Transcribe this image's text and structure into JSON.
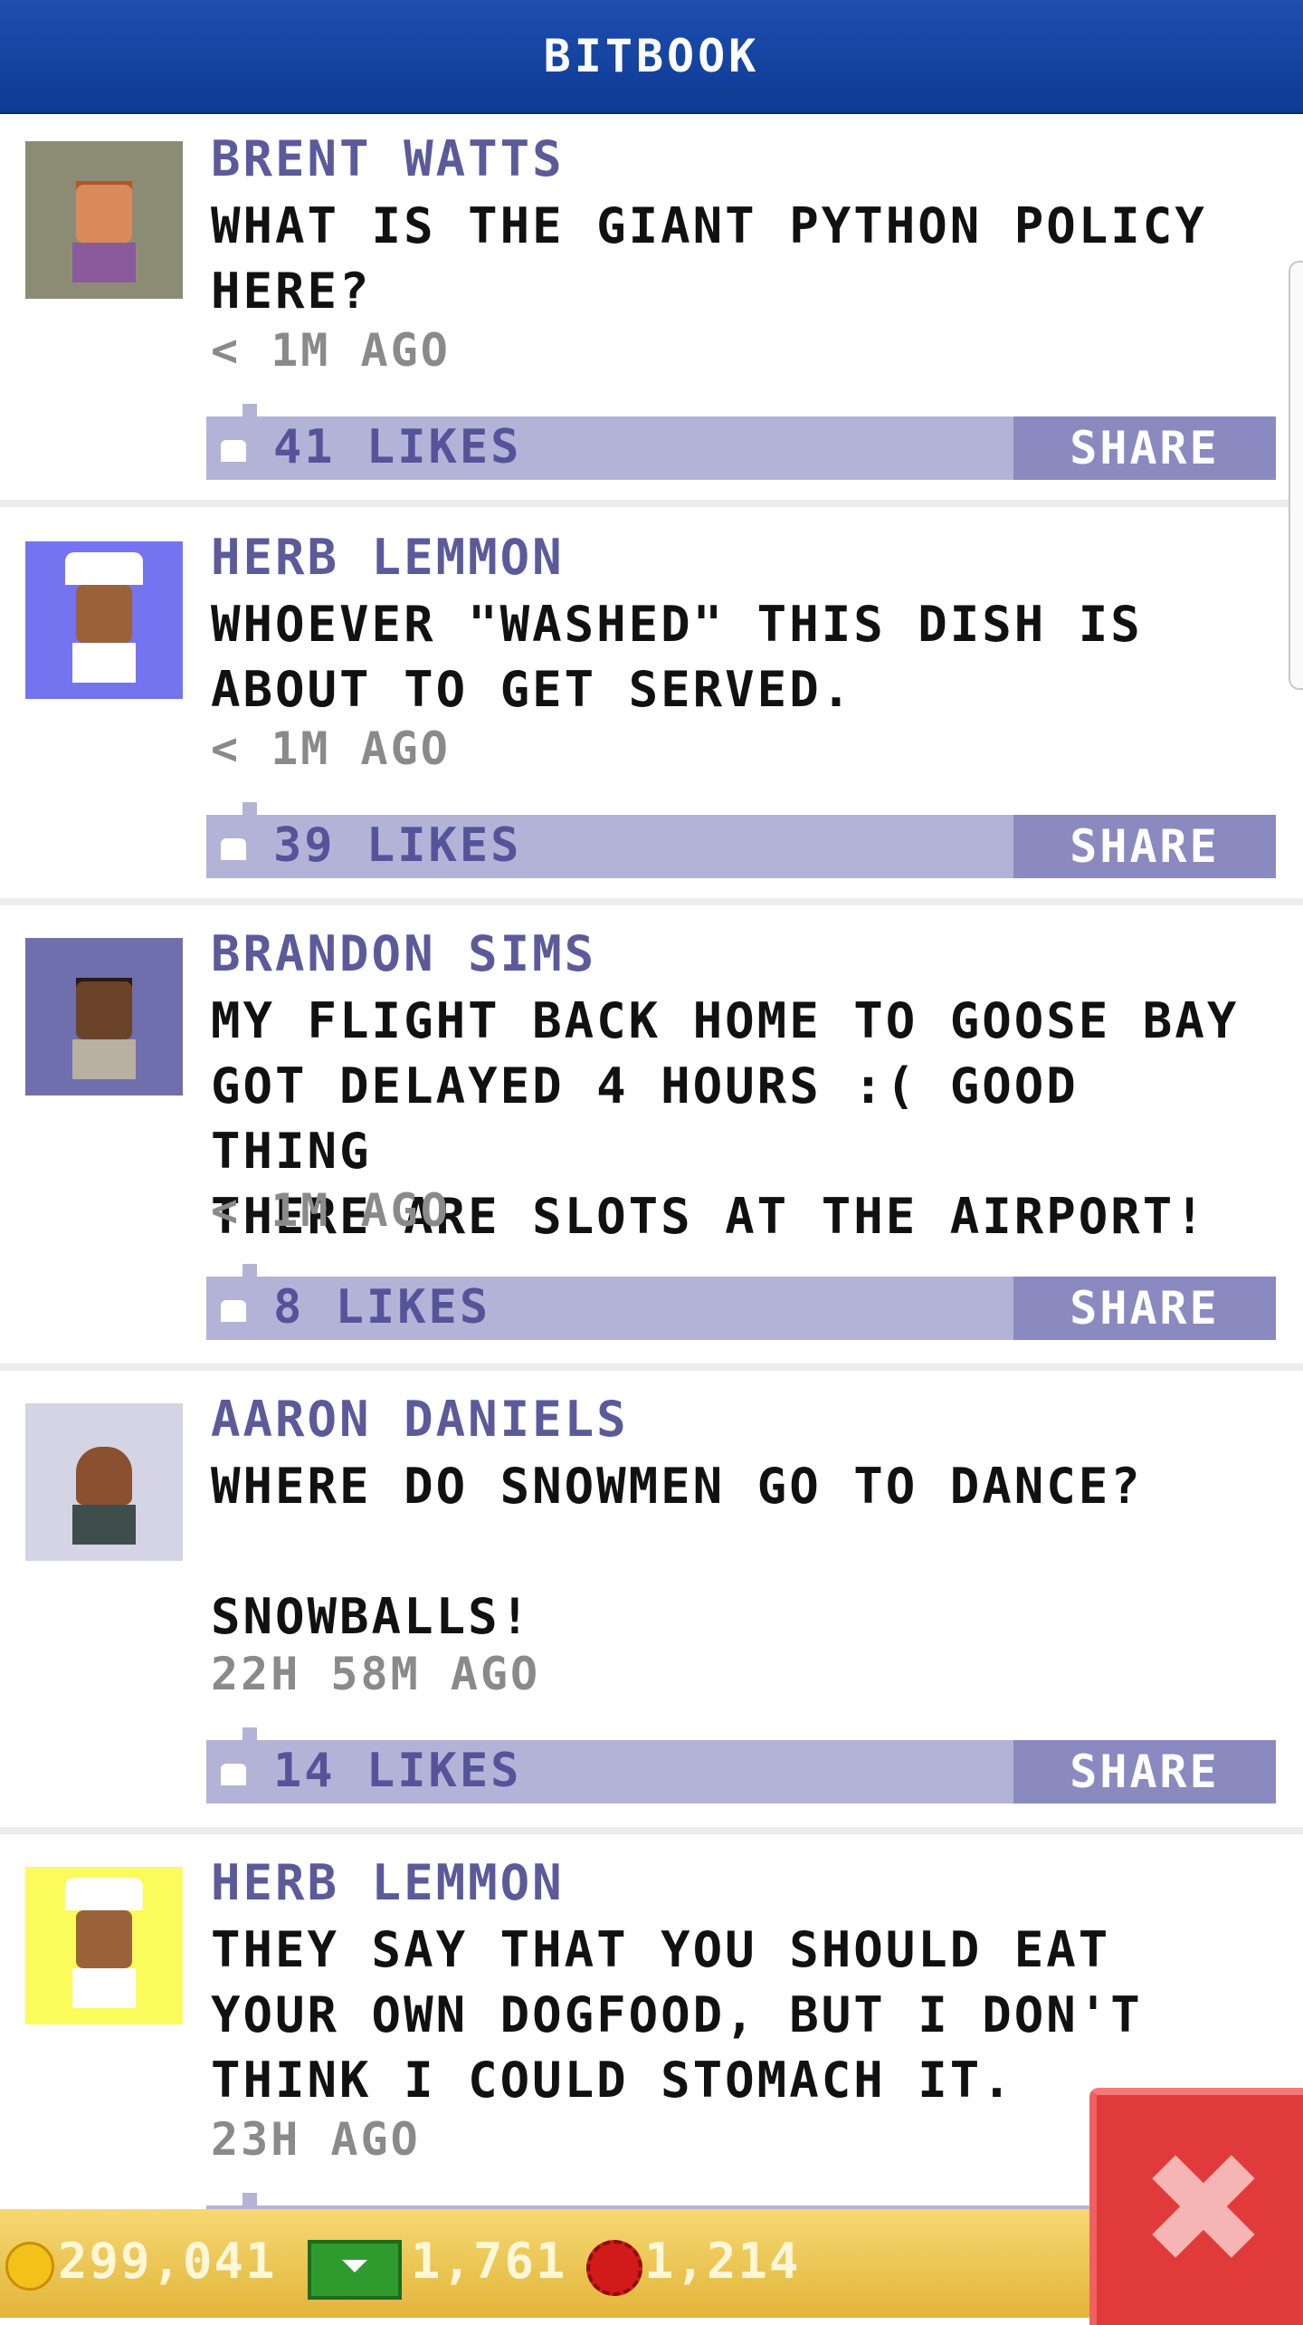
{
  "header": {
    "title": "BITBOOK"
  },
  "posts": [
    {
      "name": "BRENT WATTS",
      "text": "WHAT IS THE GIANT PYTHON POLICY\nHERE?",
      "time": "< 1M AGO",
      "likes": "41 LIKES",
      "share": "SHARE",
      "avatar_bg": "#8c8c74"
    },
    {
      "name": "HERB LEMMON",
      "text": "WHOEVER \"WASHED\" THIS DISH IS\nABOUT TO GET SERVED.",
      "time": "< 1M AGO",
      "likes": "39 LIKES",
      "share": "SHARE",
      "avatar_bg": "#7474f0"
    },
    {
      "name": "BRANDON SIMS",
      "text": "MY FLIGHT BACK HOME TO GOOSE BAY\nGOT DELAYED 4 HOURS :( GOOD THING\nTHERE ARE SLOTS AT THE AIRPORT!",
      "time": "< 1M AGO",
      "likes": "8 LIKES",
      "share": "SHARE",
      "avatar_bg": "#6f6fae"
    },
    {
      "name": "AARON DANIELS",
      "text": "WHERE DO SNOWMEN GO TO DANCE?\n\nSNOWBALLS!",
      "time": "22H 58M AGO",
      "likes": "14 LIKES",
      "share": "SHARE",
      "avatar_bg": "#d4d4e4"
    },
    {
      "name": "HERB LEMMON",
      "text": "THEY SAY THAT YOU SHOULD EAT\nYOUR OWN DOGFOOD, BUT I DON'T\nTHINK I COULD STOMACH IT.",
      "time": "23H AGO",
      "likes": "",
      "share": "",
      "avatar_bg": "#fbfb5b"
    }
  ],
  "resources": {
    "coins": "299,041",
    "cash": "1,761",
    "chips": "1,214"
  },
  "icons": {
    "like": "thumbs-up-icon",
    "coin": "coin-icon",
    "cash": "cash-icon",
    "chip": "chip-icon",
    "close": "close-icon"
  },
  "close_button": {
    "label": "✖"
  }
}
